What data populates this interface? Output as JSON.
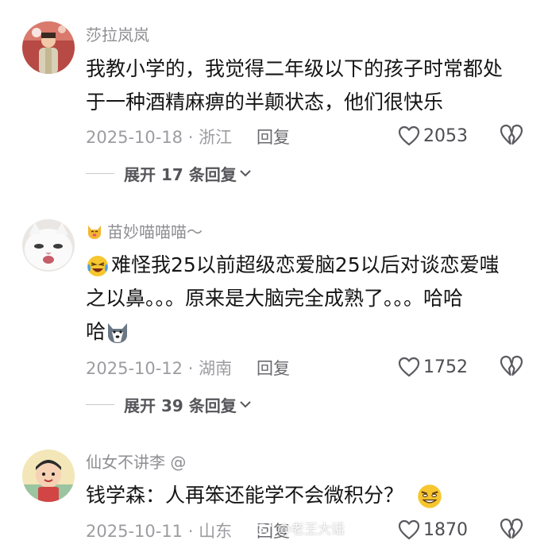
{
  "comments": [
    {
      "username": "莎拉岚岚",
      "lines": [
        "我教小学的，我觉得二年级以下的孩子时常都处",
        "于一种酒精麻痹的半颠状态，他们很快乐"
      ],
      "date_location": "2025-10-18 · 浙江",
      "reply_label": "回复",
      "like_count": "2053",
      "expand_label": "展开 17 条回复"
    },
    {
      "username": "苗妙喵喵喵～",
      "lines": [
        "难怪我25以前超级恋爱脑25以后对谈恋爱嗤",
        "之以鼻。。。原来是大脑完全成熟了。。。哈哈",
        "哈"
      ],
      "date_location": "2025-10-12 · 湖南",
      "reply_label": "回复",
      "like_count": "1752",
      "expand_label": "展开 39 条回复"
    },
    {
      "username": "仙女不讲李 @",
      "lines": [
        "钱学森：人再笨还能学不会微积分？"
      ],
      "date_location": "2025-10-11 · 山东",
      "reply_label": "回复",
      "like_count": "1870"
    }
  ],
  "watermark": "@老王大话",
  "icons": {
    "like": "heart-outline-icon",
    "dislike": "broken-heart-icon",
    "expand": "chevron-down-icon"
  }
}
